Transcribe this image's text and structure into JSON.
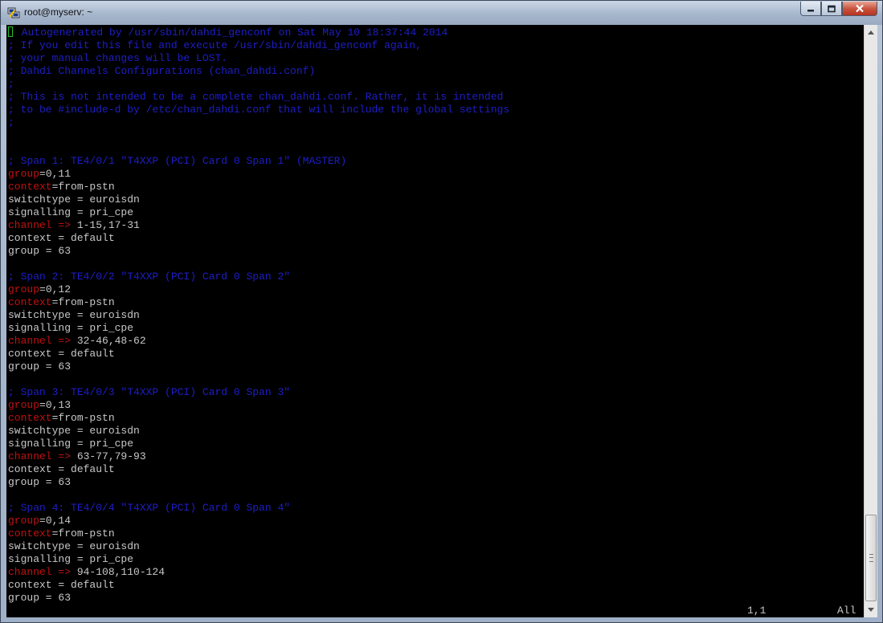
{
  "window": {
    "title": "root@myserv: ~",
    "icon": "putty-icon",
    "caption_buttons": [
      "minimize-icon",
      "maximize-icon",
      "close-icon"
    ]
  },
  "terminal": {
    "lines": [
      {
        "segments": [
          {
            "c": "comment",
            "t": " Autogenerated by /usr/sbin/dahdi_genconf on Sat May 10 18:37:44 2014"
          }
        ],
        "cursor": true
      },
      {
        "segments": [
          {
            "c": "comment",
            "t": "; If you edit this file and execute /usr/sbin/dahdi_genconf again,"
          }
        ]
      },
      {
        "segments": [
          {
            "c": "comment",
            "t": "; your manual changes will be LOST."
          }
        ]
      },
      {
        "segments": [
          {
            "c": "comment",
            "t": "; Dahdi Channels Configurations (chan_dahdi.conf)"
          }
        ]
      },
      {
        "segments": [
          {
            "c": "comment",
            "t": ";"
          }
        ]
      },
      {
        "segments": [
          {
            "c": "comment",
            "t": "; This is not intended to be a complete chan_dahdi.conf. Rather, it is intended"
          }
        ]
      },
      {
        "segments": [
          {
            "c": "comment",
            "t": "; to be #include-d by /etc/chan_dahdi.conf that will include the global settings"
          }
        ]
      },
      {
        "segments": [
          {
            "c": "comment",
            "t": ";"
          }
        ]
      },
      {
        "segments": []
      },
      {
        "segments": []
      },
      {
        "segments": [
          {
            "c": "comment",
            "t": "; Span 1: TE4/0/1 \"T4XXP (PCI) Card 0 Span 1\" (MASTER)"
          }
        ]
      },
      {
        "segments": [
          {
            "c": "key",
            "t": "group"
          },
          {
            "c": "plain",
            "t": "=0,11"
          }
        ]
      },
      {
        "segments": [
          {
            "c": "key",
            "t": "context"
          },
          {
            "c": "plain",
            "t": "=from-pstn"
          }
        ]
      },
      {
        "segments": [
          {
            "c": "plain",
            "t": "switchtype = euroisdn"
          }
        ]
      },
      {
        "segments": [
          {
            "c": "plain",
            "t": "signalling = pri_cpe"
          }
        ]
      },
      {
        "segments": [
          {
            "c": "key",
            "t": "channel =>"
          },
          {
            "c": "plain",
            "t": " 1-15,17-31"
          }
        ]
      },
      {
        "segments": [
          {
            "c": "plain",
            "t": "context = default"
          }
        ]
      },
      {
        "segments": [
          {
            "c": "plain",
            "t": "group = 63"
          }
        ]
      },
      {
        "segments": []
      },
      {
        "segments": [
          {
            "c": "comment",
            "t": "; Span 2: TE4/0/2 \"T4XXP (PCI) Card 0 Span 2\""
          }
        ]
      },
      {
        "segments": [
          {
            "c": "key",
            "t": "group"
          },
          {
            "c": "plain",
            "t": "=0,12"
          }
        ]
      },
      {
        "segments": [
          {
            "c": "key",
            "t": "context"
          },
          {
            "c": "plain",
            "t": "=from-pstn"
          }
        ]
      },
      {
        "segments": [
          {
            "c": "plain",
            "t": "switchtype = euroisdn"
          }
        ]
      },
      {
        "segments": [
          {
            "c": "plain",
            "t": "signalling = pri_cpe"
          }
        ]
      },
      {
        "segments": [
          {
            "c": "key",
            "t": "channel =>"
          },
          {
            "c": "plain",
            "t": " 32-46,48-62"
          }
        ]
      },
      {
        "segments": [
          {
            "c": "plain",
            "t": "context = default"
          }
        ]
      },
      {
        "segments": [
          {
            "c": "plain",
            "t": "group = 63"
          }
        ]
      },
      {
        "segments": []
      },
      {
        "segments": [
          {
            "c": "comment",
            "t": "; Span 3: TE4/0/3 \"T4XXP (PCI) Card 0 Span 3\""
          }
        ]
      },
      {
        "segments": [
          {
            "c": "key",
            "t": "group"
          },
          {
            "c": "plain",
            "t": "=0,13"
          }
        ]
      },
      {
        "segments": [
          {
            "c": "key",
            "t": "context"
          },
          {
            "c": "plain",
            "t": "=from-pstn"
          }
        ]
      },
      {
        "segments": [
          {
            "c": "plain",
            "t": "switchtype = euroisdn"
          }
        ]
      },
      {
        "segments": [
          {
            "c": "plain",
            "t": "signalling = pri_cpe"
          }
        ]
      },
      {
        "segments": [
          {
            "c": "key",
            "t": "channel =>"
          },
          {
            "c": "plain",
            "t": " 63-77,79-93"
          }
        ]
      },
      {
        "segments": [
          {
            "c": "plain",
            "t": "context = default"
          }
        ]
      },
      {
        "segments": [
          {
            "c": "plain",
            "t": "group = 63"
          }
        ]
      },
      {
        "segments": []
      },
      {
        "segments": [
          {
            "c": "comment",
            "t": "; Span 4: TE4/0/4 \"T4XXP (PCI) Card 0 Span 4\""
          }
        ]
      },
      {
        "segments": [
          {
            "c": "key",
            "t": "group"
          },
          {
            "c": "plain",
            "t": "=0,14"
          }
        ]
      },
      {
        "segments": [
          {
            "c": "key",
            "t": "context"
          },
          {
            "c": "plain",
            "t": "=from-pstn"
          }
        ]
      },
      {
        "segments": [
          {
            "c": "plain",
            "t": "switchtype = euroisdn"
          }
        ]
      },
      {
        "segments": [
          {
            "c": "plain",
            "t": "signalling = pri_cpe"
          }
        ]
      },
      {
        "segments": [
          {
            "c": "key",
            "t": "channel =>"
          },
          {
            "c": "plain",
            "t": " 94-108,110-124"
          }
        ]
      },
      {
        "segments": [
          {
            "c": "plain",
            "t": "context = default"
          }
        ]
      },
      {
        "segments": [
          {
            "c": "plain",
            "t": "group = 63"
          }
        ]
      }
    ],
    "status": {
      "position": "1,1",
      "scroll": "All"
    }
  },
  "colors": {
    "comment": "#1e1ec8",
    "key": "#c01010",
    "text": "#c8c8c8",
    "cursor": "#20c020",
    "background": "#000000"
  }
}
